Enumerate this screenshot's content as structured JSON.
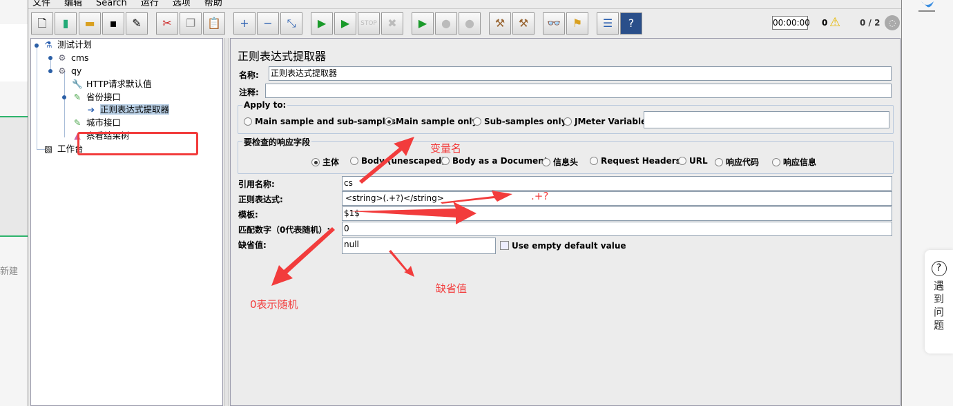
{
  "background": {
    "new_label": "新建",
    "help_widget": {
      "icon": "question-icon",
      "label": "遇到问题"
    }
  },
  "menu": [
    "文件",
    "编辑",
    "Search",
    "运行",
    "选项",
    "帮助"
  ],
  "toolbar": {
    "buttons": [
      "new",
      "templates",
      "open",
      "save",
      "save-as",
      "cut",
      "copy",
      "paste",
      "expand",
      "collapse",
      "toggle",
      "start",
      "start-no-pauses",
      "stop",
      "shutdown",
      "remote-start",
      "remote-stop",
      "remote-exit",
      "clear",
      "clear-all",
      "search",
      "reset-search",
      "function-helper",
      "help"
    ],
    "timer": "00:00:00",
    "error_count": "0",
    "threads": "0 / 2"
  },
  "tree": {
    "items": [
      {
        "label": "测试计划",
        "icon": "test-plan-flask-icon"
      },
      {
        "label": "cms",
        "icon": "thread-group-gear-icon"
      },
      {
        "label": "qy",
        "icon": "thread-group-gear-icon"
      },
      {
        "label": "HTTP请求默认值",
        "icon": "wrench-icon"
      },
      {
        "label": "省份接口",
        "icon": "pipette-sampler-icon"
      },
      {
        "label": "正则表达式提取器",
        "icon": "arrow-extractor-icon",
        "selected": true
      },
      {
        "label": "城市接口",
        "icon": "pipette-sampler-icon"
      },
      {
        "label": "察看结果树",
        "icon": "chart-listener-icon"
      },
      {
        "label": "工作台",
        "icon": "workbench-icon"
      }
    ]
  },
  "panel": {
    "title": "正则表达式提取器",
    "name_label": "名称:",
    "name_value": "正则表达式提取器",
    "comment_label": "注释:",
    "comment_value": "",
    "apply_to": {
      "title": "Apply to:",
      "options": [
        "Main sample and sub-samples",
        "Main sample only",
        "Sub-samples only",
        "JMeter Variable"
      ],
      "selected": "Main sample only",
      "variable_value": ""
    },
    "field": {
      "title": "要检查的响应字段",
      "options": [
        "主体",
        "Body (unescaped)",
        "Body as a Document",
        "信息头",
        "Request Headers",
        "URL",
        "响应代码",
        "响应信息"
      ],
      "selected": "主体"
    },
    "ref_label": "引用名称:",
    "ref_value": "cs",
    "regex_label": "正则表达式:",
    "regex_value": "<string>(.+?)</string>",
    "template_label": "模板:",
    "template_value": "$1$",
    "match_label": "匹配数字（0代表随机）:",
    "match_value": "0",
    "default_label": "缺省值:",
    "default_value": "null",
    "empty_default_label": "Use empty default value",
    "empty_default_checked": false
  },
  "annotations": {
    "var_name": "变量名",
    "regex_hint": ".+?",
    "default_hint": "缺省值",
    "random_hint": "0表示随机",
    "color": "#f23c3c"
  }
}
